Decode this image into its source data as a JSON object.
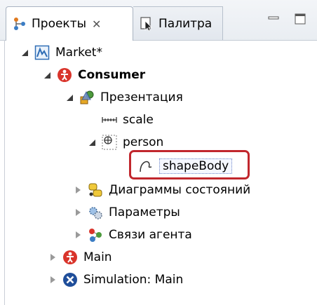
{
  "tabs": [
    {
      "label": "Проекты",
      "icon": "projects-icon",
      "active": true,
      "close": "✕"
    },
    {
      "label": "Палитра",
      "icon": "palette-icon",
      "active": false
    }
  ],
  "window_controls": [
    "minimize-icon",
    "maximize-icon"
  ],
  "tree": {
    "market": "Market*",
    "consumer": "Consumer",
    "presentation": "Презентация",
    "scale": "scale",
    "person": "person",
    "shapebody": "shapeBody",
    "statecharts": "Диаграммы состояний",
    "parameters": "Параметры",
    "agent_links": "Связи агента",
    "main": "Main",
    "simulation": "Simulation: Main"
  },
  "colors": {
    "selection_outline": "#c1272d",
    "agent_icon": "#d9342b",
    "simulation_icon": "#1f4e9a"
  }
}
